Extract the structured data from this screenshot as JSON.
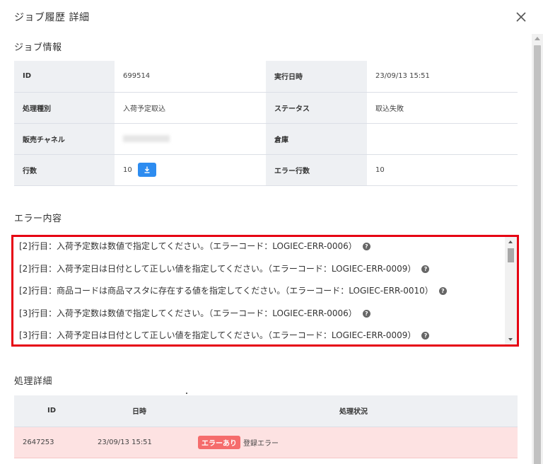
{
  "modal": {
    "title": "ジョブ履歴 詳細"
  },
  "job_info": {
    "section_title": "ジョブ情報",
    "rows": [
      {
        "label1": "ID",
        "value1": "699514",
        "label2": "実行日時",
        "value2": "23/09/13 15:51"
      },
      {
        "label1": "処理種別",
        "value1": "入荷予定取込",
        "label2": "ステータス",
        "value2": "取込失敗"
      },
      {
        "label1": "販売チャネル",
        "value1": "",
        "label2": "倉庫",
        "value2": ""
      },
      {
        "label1": "行数",
        "value1": "10",
        "label2": "エラー行数",
        "value2": "10"
      }
    ]
  },
  "errors": {
    "section_title": "エラー内容",
    "items": [
      "[2]行目：入荷予定数は数値で指定してください。（エラーコード：LOGIEC-ERR-0006）",
      "[2]行目：入荷予定日は日付として正しい値を指定してください。（エラーコード：LOGIEC-ERR-0009）",
      "[2]行目：商品コードは商品マスタに存在する値を指定してください。（エラーコード：LOGIEC-ERR-0010）",
      "[3]行目：入荷予定数は数値で指定してください。（エラーコード：LOGIEC-ERR-0006）",
      "[3]行目：入荷予定日は日付として正しい値を指定してください。（エラーコード：LOGIEC-ERR-0009）"
    ]
  },
  "process": {
    "section_title": "処理詳細",
    "headers": {
      "id": "ID",
      "datetime": "日時",
      "status": "処理状況"
    },
    "rows": [
      {
        "id": "2647253",
        "datetime": "23/09/13 15:51",
        "badge": "エラーあり",
        "status": "登録エラー"
      }
    ]
  },
  "colors": {
    "accent": "#2d8cf0",
    "highlight_border": "#e60012",
    "error_badge": "#f56c6c",
    "error_row": "#fde2e2"
  },
  "icons": {
    "close": "close-icon",
    "download": "download-icon",
    "help": "help-icon"
  }
}
